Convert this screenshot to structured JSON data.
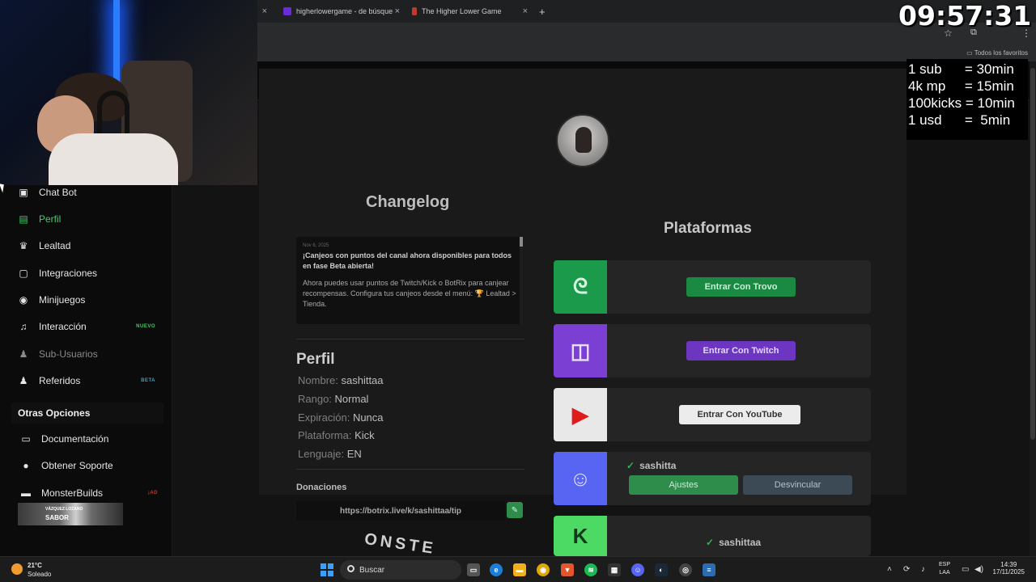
{
  "browser": {
    "tabs": [
      {
        "title": "higherlowergame - de búsque"
      },
      {
        "title": "The Higher Lower Game"
      }
    ],
    "new_tab": "+",
    "bookmarks_all": "Todos los favoritos"
  },
  "overlay": {
    "clock": "09:57:31",
    "rates": [
      "1 sub      = 30min",
      "4k mp     = 15min",
      "100kicks = 10min",
      "1 usd      =  5min"
    ],
    "sponsor_small": "VÁZQUEZ LOZANO",
    "sponsor_big": "SABOR"
  },
  "sidebar": {
    "items": [
      {
        "label": "Chat Bot",
        "icon": "robot-icon"
      },
      {
        "label": "Perfil",
        "icon": "id-card-icon"
      },
      {
        "label": "Lealtad",
        "icon": "trophy-icon"
      },
      {
        "label": "Integraciones",
        "icon": "window-icon"
      },
      {
        "label": "Minijuegos",
        "icon": "gamepad-icon"
      },
      {
        "label": "Interacción",
        "icon": "music-icon",
        "badge": "NUEVO"
      },
      {
        "label": "Sub-Usuarios",
        "icon": "user-lock-icon"
      },
      {
        "label": "Referidos",
        "icon": "users-icon",
        "badge": "BETA"
      }
    ],
    "section_title": "Otras Opciones",
    "other": [
      {
        "label": "Documentación",
        "icon": "book-icon"
      },
      {
        "label": "Obtener Soporte",
        "icon": "question-icon"
      },
      {
        "label": "MonsterBuilds",
        "icon": "laptop-icon",
        "badge": "¡AD"
      }
    ]
  },
  "changelog": {
    "title": "Changelog",
    "date": "Nov 6, 2025",
    "headline": "¡Canjeos con puntos del canal ahora disponibles para todos en fase Beta abierta!",
    "body": "Ahora puedes usar puntos de Twitch/Kick o BotRix para canjear recompensas. Configura tus canjeos desde el menú: 🏆 Lealtad > Tienda."
  },
  "profile": {
    "title": "Perfil",
    "rows": [
      {
        "label": "Nombre:",
        "value": "sashittaa"
      },
      {
        "label": "Rango:",
        "value": "Normal"
      },
      {
        "label": "Expiración:",
        "value": "Nunca"
      },
      {
        "label": "Plataforma:",
        "value": "Kick"
      },
      {
        "label": "Lenguaje:",
        "value": "EN"
      }
    ]
  },
  "donations": {
    "title": "Donaciones",
    "url": "https://botrix.live/k/sashittaa/tip",
    "logo_text": "ONSTE"
  },
  "platforms": {
    "title": "Plataformas",
    "trovo_btn": "Entrar Con Trovo",
    "twitch_btn": "Entrar Con Twitch",
    "youtube_btn": "Entrar Con YouTube",
    "discord_user": "sashitta",
    "discord_settings": "Ajustes",
    "discord_unlink": "Desvincular",
    "kick_user": "sashittaa",
    "colors": {
      "trovo": "#1a9a4a",
      "twitch": "#7b3fd4",
      "youtube": "#e8e8e8",
      "discord": "#5865f2",
      "kick": "#4cd964"
    }
  },
  "taskbar": {
    "temp": "21°C",
    "weather": "Soleado",
    "search": "Buscar",
    "lang1": "ESP",
    "lang2": "LAA",
    "time": "14:39",
    "date": "17/11/2025"
  }
}
